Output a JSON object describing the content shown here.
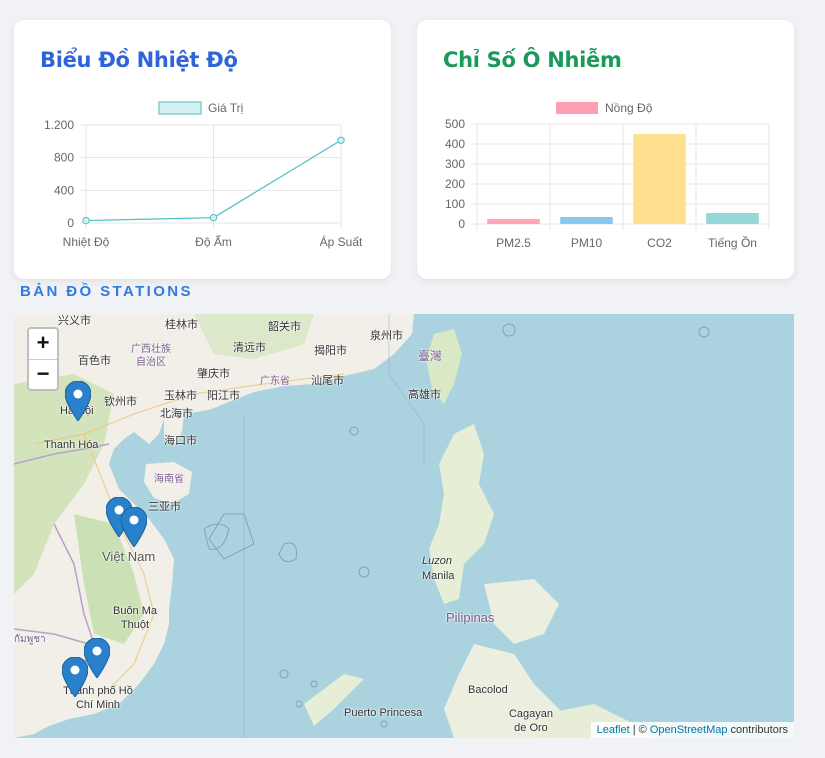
{
  "temperature_card": {
    "title": "Biểu Đồ Nhiệt Độ",
    "chart_data": {
      "type": "line",
      "categories": [
        "Nhiệt Độ",
        "Độ Ẩm",
        "Áp Suất"
      ],
      "series": [
        {
          "name": "Giá Trị",
          "values": [
            30,
            65,
            1013
          ]
        }
      ],
      "ylim": [
        0,
        1200
      ],
      "yticks": [
        "0",
        "400",
        "800",
        "1.200"
      ],
      "ytick_values": [
        0,
        400,
        800,
        1200
      ],
      "legend": "top",
      "grid": true,
      "colors": {
        "line": "#4bc0c0",
        "fill": "#d6f1f1"
      }
    }
  },
  "pollution_card": {
    "title": "Chỉ Số Ô Nhiễm",
    "chart_data": {
      "type": "bar",
      "categories": [
        "PM2.5",
        "PM10",
        "CO2",
        "Tiếng Ồn"
      ],
      "series": [
        {
          "name": "Nồng Độ",
          "values": [
            25,
            35,
            450,
            55
          ]
        }
      ],
      "ylim": [
        0,
        500
      ],
      "yticks": [
        "0",
        "100",
        "200",
        "300",
        "400",
        "500"
      ],
      "ytick_values": [
        0,
        100,
        200,
        300,
        400,
        500
      ],
      "legend": "top",
      "grid": true,
      "colors": {
        "legend": "#ff9fb3",
        "bars": [
          "#ffa3b5",
          "#8ac8f0",
          "#ffe08f",
          "#95d8d8"
        ]
      }
    }
  },
  "map_section": {
    "heading": "BẢN ĐỒ STATIONS",
    "zoom_in": "+",
    "zoom_out": "−",
    "labels": [
      "Hà Nội",
      "Thanh Hóa",
      "Việt Nam",
      "Buôn Ma Thuột",
      "Thành phố Hồ Chí Minh",
      "Manila",
      "Luzon",
      "Pilipinas",
      "Bacolod",
      "Puerto Princesa",
      "Cagayan de Oro",
      "海口市",
      "海南省",
      "三亚市",
      "北海市",
      "玉林市",
      "阳江市",
      "肇庆市",
      "清远市",
      "揭阳市",
      "汕尾市",
      "泉州市",
      "高雄市",
      "臺灣",
      "广西壮族自治区",
      "广东省",
      "桂林市",
      "韶关市",
      "钦州市",
      "百色市",
      "兴义市",
      "กัมพูชา"
    ],
    "attribution": {
      "leaflet": "Leaflet",
      "sep": " | © ",
      "osm": "OpenStreetMap",
      "suffix": " contributors"
    },
    "colors": {
      "sea": "#aad3df",
      "land": "#f2efe9",
      "forest": "#c8deb0",
      "border": "#b6a3c7",
      "marker": "#2a81cb"
    }
  }
}
